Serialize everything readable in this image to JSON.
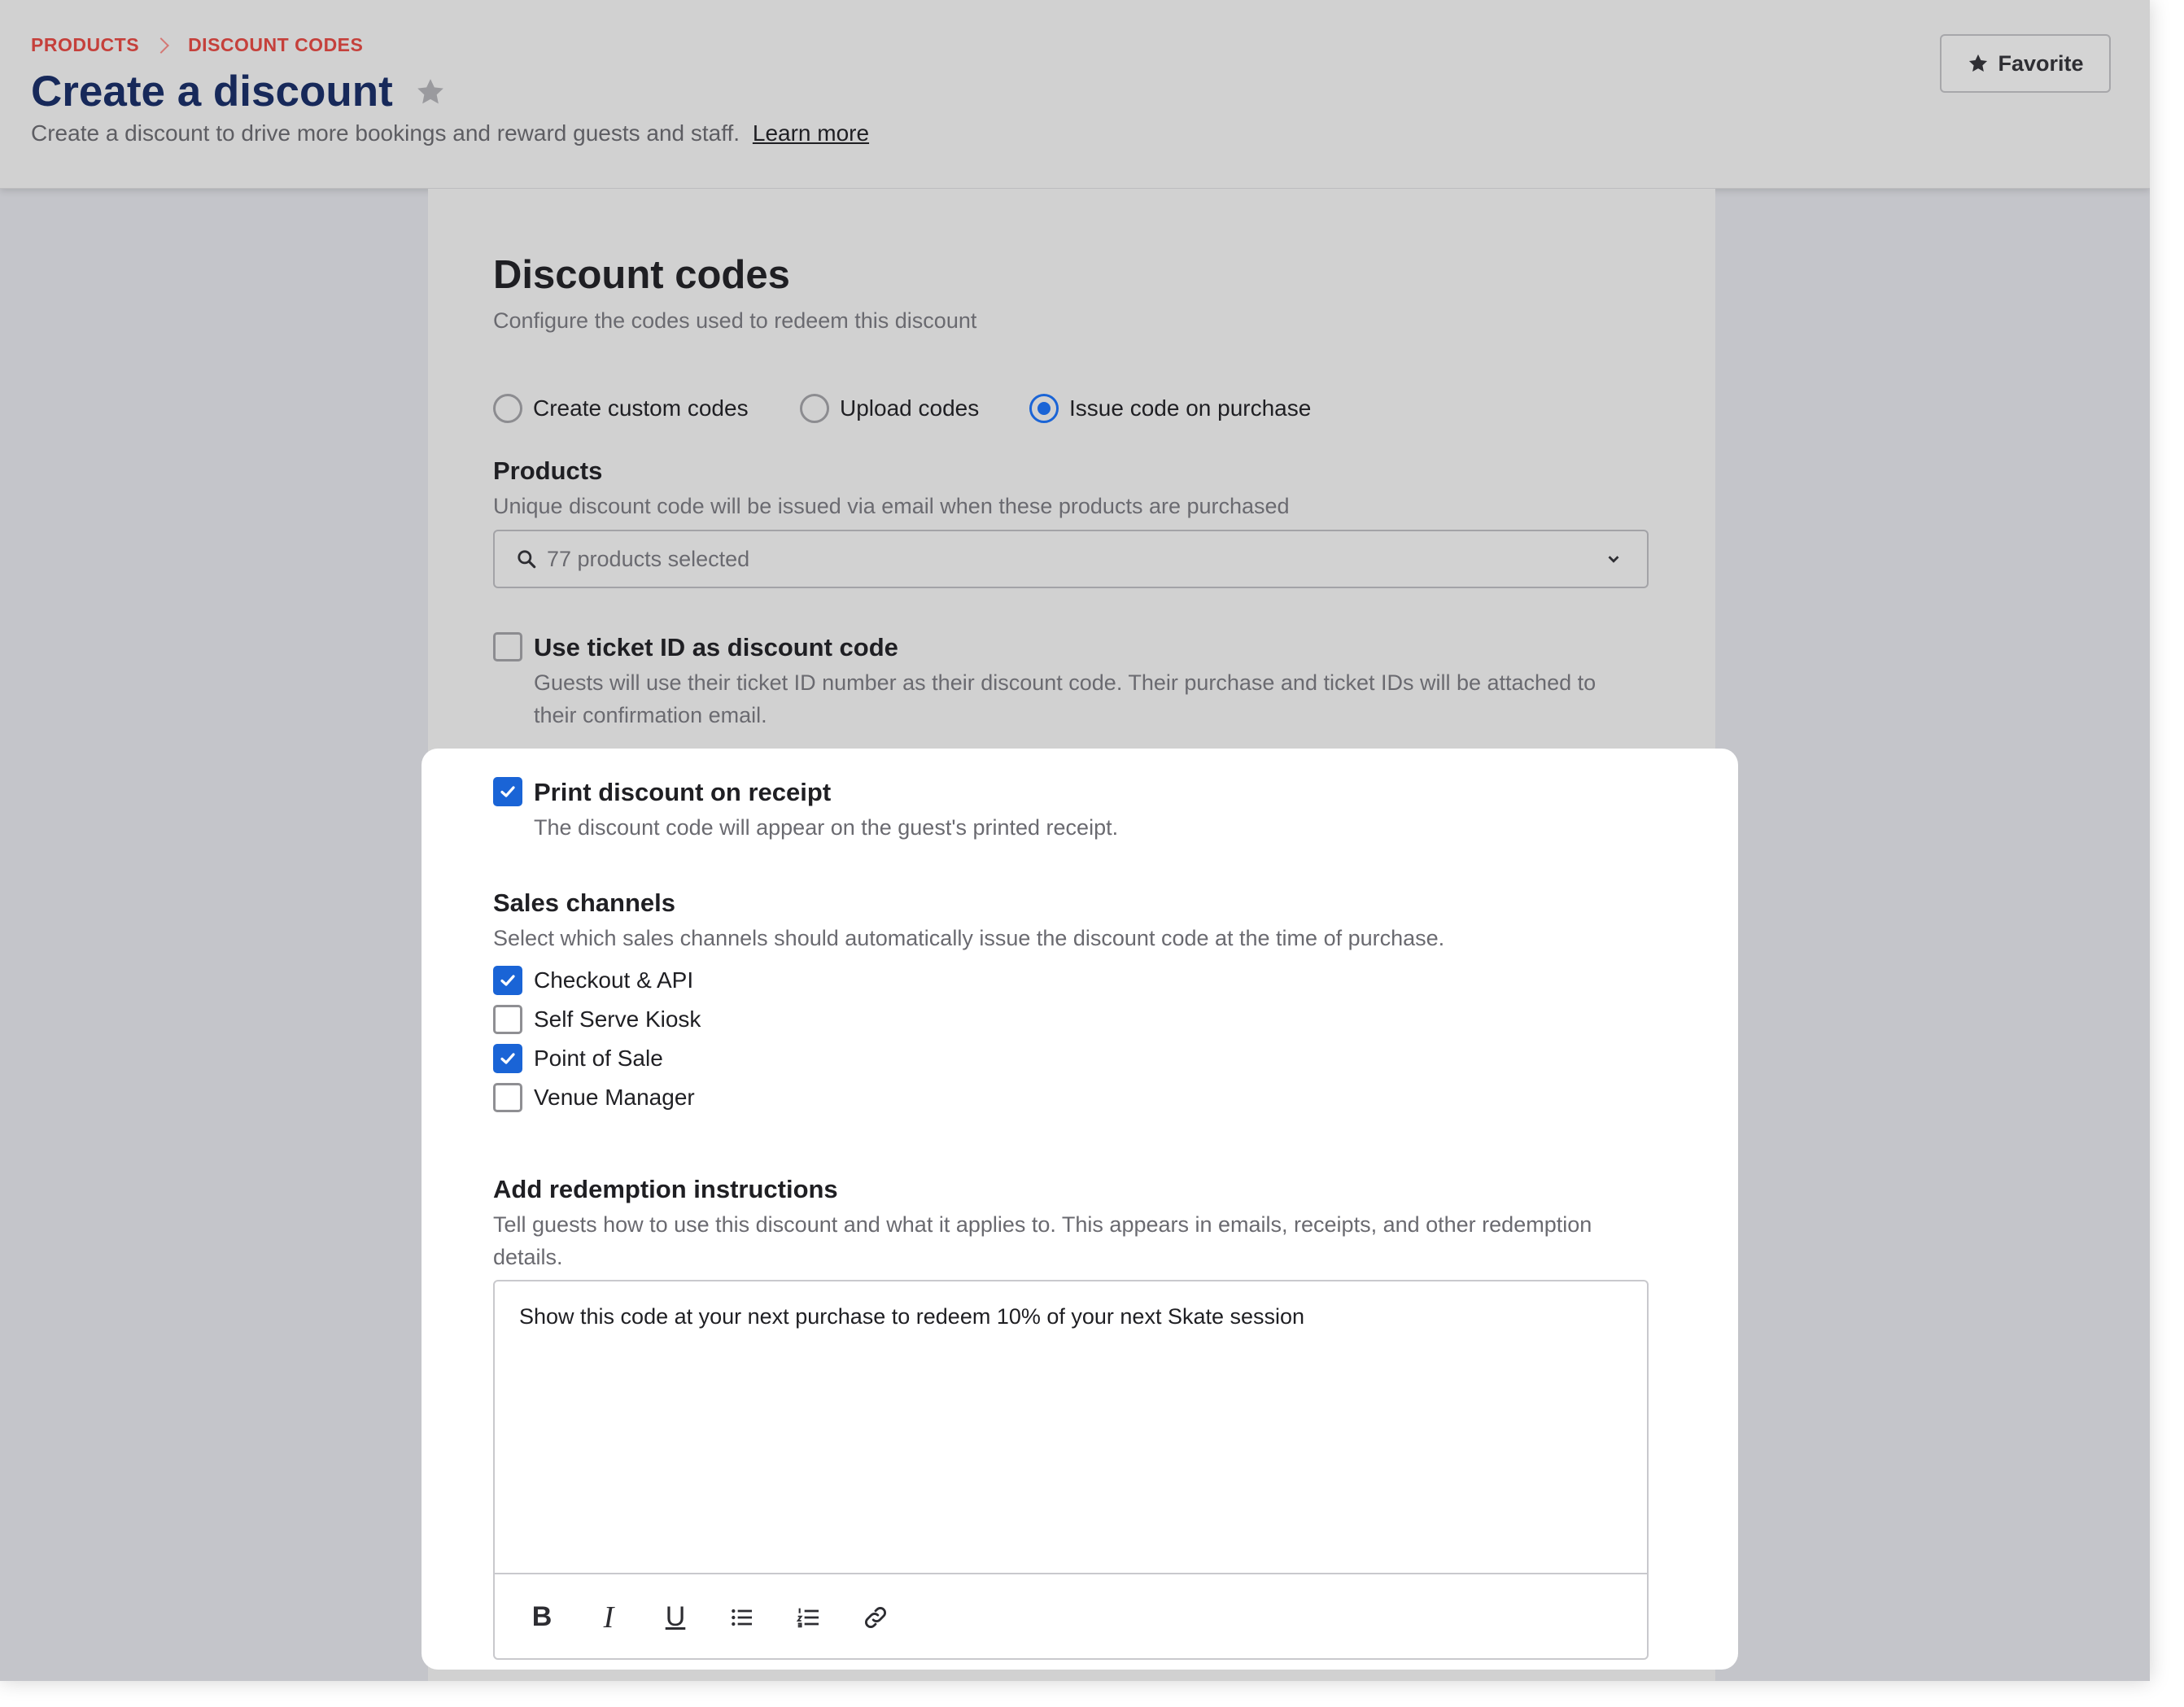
{
  "header": {
    "breadcrumb": [
      "PRODUCTS",
      "DISCOUNT CODES"
    ],
    "title": "Create a discount",
    "subtitle": "Create a discount to drive more bookings and reward guests and staff.",
    "learn_more": "Learn more",
    "favorite_label": "Favorite"
  },
  "section": {
    "title": "Discount codes",
    "subtitle": "Configure the codes used to redeem this discount",
    "code_options": [
      {
        "label": "Create custom codes",
        "selected": false
      },
      {
        "label": "Upload codes",
        "selected": false
      },
      {
        "label": "Issue code on purchase",
        "selected": true
      }
    ]
  },
  "products": {
    "label": "Products",
    "help": "Unique discount code will be issued via email when these products are purchased",
    "selected_text": "77 products selected"
  },
  "ticket_id": {
    "label": "Use ticket ID as discount code",
    "checked": false,
    "help_line1": "Guests will use their ticket ID number as their discount code. Their purchase and ticket IDs will be attached to",
    "help_line2": "their confirmation email."
  },
  "print_receipt": {
    "label": "Print discount on receipt",
    "checked": true,
    "help": "The discount code will appear on the guest's printed receipt."
  },
  "sales_channels": {
    "label": "Sales channels",
    "help": "Select which sales channels should automatically issue the discount code at the time of purchase.",
    "items": [
      {
        "label": "Checkout & API",
        "checked": true
      },
      {
        "label": "Self Serve Kiosk",
        "checked": false
      },
      {
        "label": "Point of Sale",
        "checked": true
      },
      {
        "label": "Venue Manager",
        "checked": false
      }
    ]
  },
  "redemption": {
    "label": "Add redemption instructions",
    "help_line1": "Tell guests how to use this discount and what it applies to. This appears in emails, receipts, and other redemption",
    "help_line2": "details.",
    "value": "Show this code at your next purchase to redeem 10% of your next Skate session",
    "toolbar": [
      "bold-icon",
      "italic-icon",
      "underline-icon",
      "bullet-list-icon",
      "numbered-list-icon",
      "link-icon"
    ]
  },
  "colors": {
    "accent": "#1a64d6",
    "breadcrumb": "#c5403b",
    "title": "#17295a"
  }
}
